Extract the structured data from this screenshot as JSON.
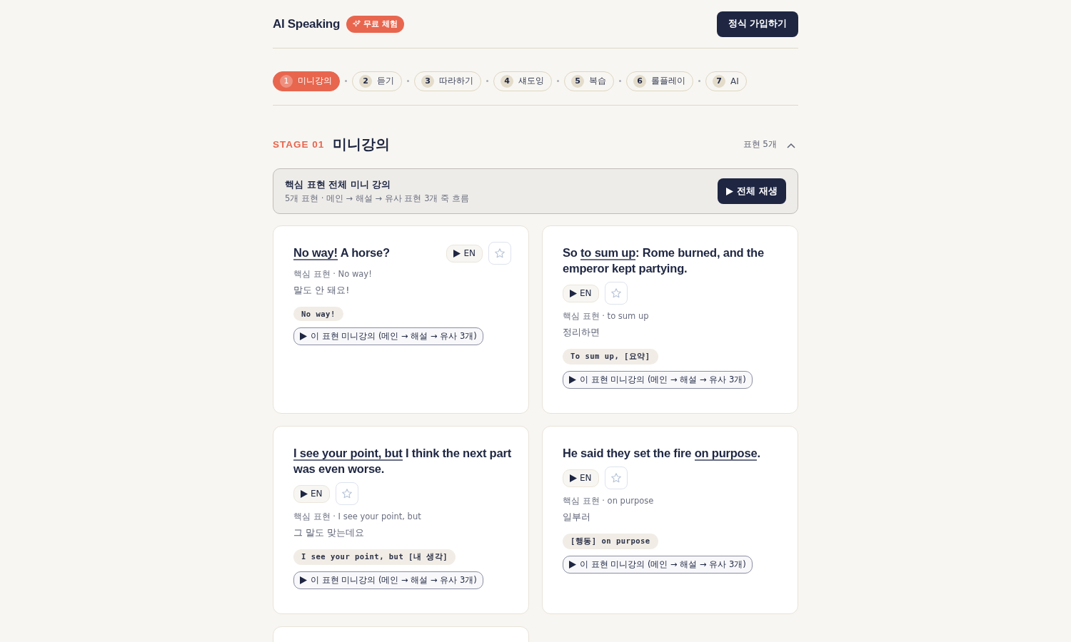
{
  "header": {
    "brand": "AI Speaking",
    "trial_badge": "무료 체험",
    "signup_button": "정식 가입하기"
  },
  "steps": [
    {
      "number": "1",
      "label": "미니강의",
      "selected": true
    },
    {
      "number": "2",
      "label": "듣기",
      "selected": false
    },
    {
      "number": "3",
      "label": "따라하기",
      "selected": false
    },
    {
      "number": "4",
      "label": "섀도잉",
      "selected": false
    },
    {
      "number": "5",
      "label": "복습",
      "selected": false
    },
    {
      "number": "6",
      "label": "롤플레이",
      "selected": false
    },
    {
      "number": "7",
      "label": "AI",
      "selected": false
    }
  ],
  "stage": {
    "label": "STAGE 01",
    "title": "미니강의",
    "count": "표현 5개",
    "expanded": true,
    "banner": {
      "title": "핵심 표현 전체 미니 강의",
      "subtitle": "5개 표현 · 메인 → 해설 → 유사 표현 3개 죽 흐름",
      "play_button": "전체 재생"
    }
  },
  "cards": [
    {
      "kind": "inline",
      "sentence": [
        {
          "text": "No way!",
          "key": true
        },
        {
          "text": " A horse?",
          "key": false
        }
      ],
      "audio_button": "EN",
      "favorite": false,
      "meta": "핵심 표현 · No way!",
      "meaning": "말도 안 돼요!",
      "pattern": "No way!",
      "lecture_button": "이 표현 미니강의 (메인 → 해설 → 유사 3개)"
    },
    {
      "kind": "stacked",
      "sentence": [
        {
          "text": "So ",
          "key": false
        },
        {
          "text": "to sum up",
          "key": true
        },
        {
          "text": ": Rome burned, and the emperor kept partying.",
          "key": false
        }
      ],
      "audio_button": "EN",
      "favorite": false,
      "meta": "핵심 표현 · to sum up",
      "meaning": "정리하면",
      "pattern": "To sum up, [요약]",
      "lecture_button": "이 표현 미니강의 (메인 → 해설 → 유사 3개)"
    },
    {
      "kind": "stacked",
      "sentence": [
        {
          "text": "I see your point, but",
          "key": true
        },
        {
          "text": " I think the next part was even worse.",
          "key": false
        }
      ],
      "audio_button": "EN",
      "favorite": false,
      "meta": "핵심 표현 · I see your point, but",
      "meaning": "그 말도 맞는데요",
      "pattern": "I see your point, but [내 생각]",
      "lecture_button": "이 표현 미니강의 (메인 → 해설 → 유사 3개)"
    },
    {
      "kind": "stacked",
      "sentence": [
        {
          "text": "He said they set the fire ",
          "key": false
        },
        {
          "text": "on purpose",
          "key": true
        },
        {
          "text": ".",
          "key": false
        }
      ],
      "audio_button": "EN",
      "favorite": false,
      "meta": "핵심 표현 · on purpose",
      "meaning": "일부러",
      "pattern": "[행동] on purpose",
      "lecture_button": "이 표현 미니강의 (메인 → 해설 → 유사 3개)"
    },
    {
      "kind": "cut_off"
    }
  ]
}
